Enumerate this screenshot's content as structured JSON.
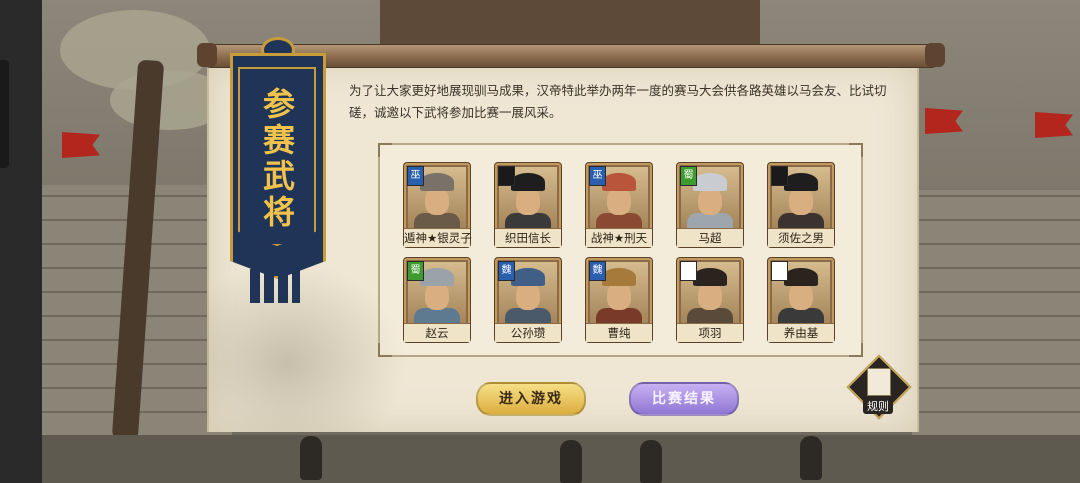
{
  "banner": {
    "title": "参赛武将"
  },
  "intro": {
    "text": "为了让大家更好地展现驯马成果，汉帝特此举办两年一度的赛马大会供各路英雄以马会友、比试切磋，诚邀以下武将参加比赛一展风采。"
  },
  "generals": [
    {
      "name": "遁神★银灵子",
      "faction": "巫",
      "faction_color": "#2a5fb0"
    },
    {
      "name": "织田信长",
      "faction": "",
      "faction_color": "#1a1a1a"
    },
    {
      "name": "战神★刑天",
      "faction": "巫",
      "faction_color": "#2a5fb0"
    },
    {
      "name": "马超",
      "faction": "蜀",
      "faction_color": "#3e9b2f"
    },
    {
      "name": "须佐之男",
      "faction": "",
      "faction_color": "#1a1a1a"
    },
    {
      "name": "赵云",
      "faction": "蜀",
      "faction_color": "#3e9b2f"
    },
    {
      "name": "公孙瓒",
      "faction": "魏",
      "faction_color": "#2a5fb0"
    },
    {
      "name": "曹纯",
      "faction": "魏",
      "faction_color": "#2a5fb0"
    },
    {
      "name": "项羽",
      "faction": "",
      "faction_color": "#ffffff"
    },
    {
      "name": "养由基",
      "faction": "",
      "faction_color": "#ffffff"
    }
  ],
  "buttons": {
    "enter": "进入游戏",
    "results": "比赛结果"
  },
  "rules": {
    "label": "规则"
  }
}
